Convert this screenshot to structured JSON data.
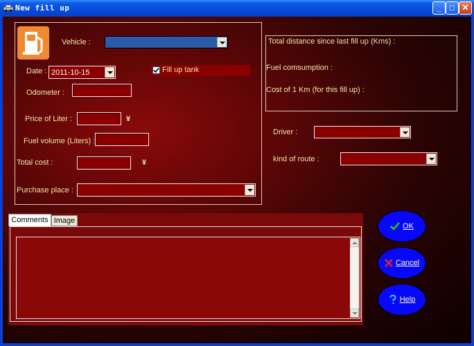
{
  "window": {
    "title": "New fill up",
    "minimize_glyph": "_",
    "maximize_glyph": "□",
    "close_glyph": "✕"
  },
  "form": {
    "vehicle_label": "Vehicle :",
    "vehicle_value": "",
    "date_label": "Date :",
    "date_value": "2011-10-15",
    "fill_up_tank_label": "Fill up tank",
    "fill_up_tank_checked": true,
    "odometer_label": "Odometer :",
    "price_label": "Price of Liter :",
    "price_currency": "¥",
    "volume_label": "Fuel volume (Liters) :",
    "total_cost_label": "Total cost :",
    "total_cost_currency": "¥",
    "purchase_place_label": "Purchase place :"
  },
  "stats": {
    "distance_label": "Total distance since last fill up (Kms) :",
    "consumption_label": "Fuel comsumption :",
    "cost_per_km_label": "Cost of 1 Km (for this fill up) :"
  },
  "extra": {
    "driver_label": "Driver :",
    "route_label": "kind of route :"
  },
  "tabs": [
    {
      "label": "Comments",
      "active": true
    },
    {
      "label": "Image",
      "active": false
    }
  ],
  "buttons": {
    "ok_label": "OK",
    "cancel_label": "Cancel",
    "help_label": "Help"
  },
  "colors": {
    "label_text": "#f2e7a6",
    "field_bg": "#8a0000",
    "button_blue": "#0808f8",
    "title_blue": "#0a5ae8"
  },
  "icons": {
    "window_icon": "car-icon",
    "form_icon": "fuel-pump-icon",
    "ok_icon": "check-icon",
    "cancel_icon": "x-icon",
    "help_icon": "question-icon"
  }
}
